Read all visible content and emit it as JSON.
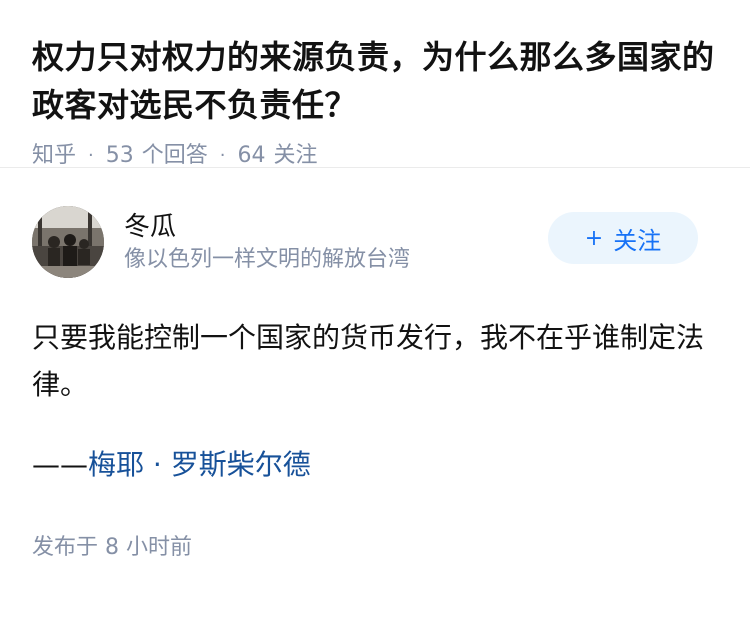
{
  "question": {
    "title": "权力只对权力的来源负责，为什么那么多国家的政客对选民不负责任？",
    "source": "知乎",
    "separator": "·",
    "answer_count": "53",
    "answer_label": "个回答",
    "follow_count": "64",
    "follow_label": "关注"
  },
  "answer": {
    "author": {
      "name": "冬瓜",
      "bio": "像以色列一样文明的解放台湾",
      "avatar_icon": "avatar-photo"
    },
    "follow_button": {
      "icon": "+",
      "label": "关注"
    },
    "content": "只要我能控制一个国家的货币发行，我不在乎谁制定法律。",
    "quote_dash": "——",
    "quote_author_link": "梅耶 · 罗斯柴尔德",
    "publish_time": "发布于 8 小时前"
  },
  "colors": {
    "title": "#121212",
    "meta": "#8590a6",
    "link": "#175199",
    "follow_bg": "#ebf5fd",
    "follow_text": "#1772f6"
  }
}
